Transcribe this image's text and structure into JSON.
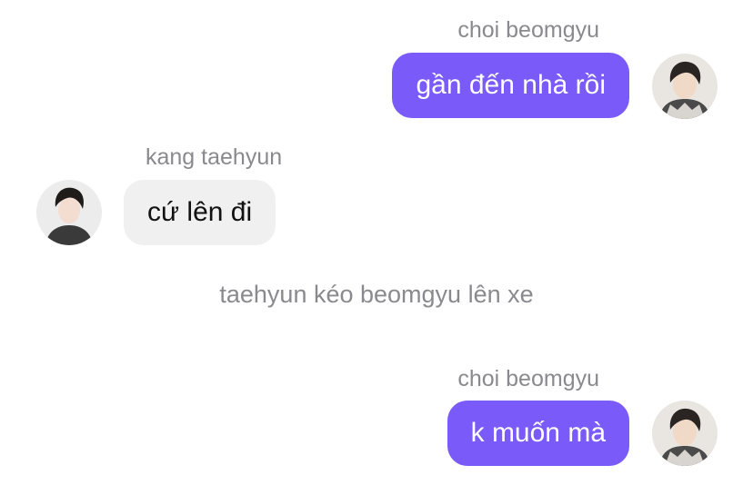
{
  "messages": [
    {
      "sender": "choi beomgyu",
      "text": "gần đến nhà rồi",
      "direction": "outgoing",
      "avatar": "avatar-beomgyu"
    },
    {
      "sender": "kang taehyun",
      "text": "cứ lên đi",
      "direction": "incoming",
      "avatar": "avatar-taehyun"
    },
    {
      "system": "taehyun kéo beomgyu lên xe"
    },
    {
      "sender": "choi beomgyu",
      "text": "k muốn mà",
      "direction": "outgoing",
      "avatar": "avatar-beomgyu"
    }
  ],
  "colors": {
    "outgoing_bubble": "#7a5af8",
    "incoming_bubble": "#f0f0f0",
    "meta_text": "#8a8a8e"
  }
}
